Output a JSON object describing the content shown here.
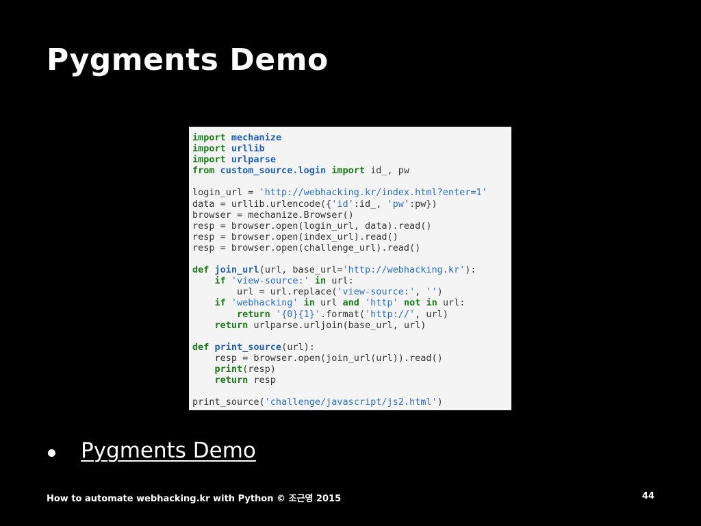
{
  "slide": {
    "title": "Pygments Demo",
    "bullet": "Pygments Demo",
    "footer": "How to automate webhacking.kr with Python © 조근영 2015",
    "page_number": "44"
  },
  "colors": {
    "background": "#000000",
    "text": "#ffffff",
    "code_background": "#f4f4f4",
    "keyword": "#1a7a1a",
    "name": "#1f5fb3",
    "string": "#2a6fbf",
    "plain": "#333333"
  },
  "code": {
    "language": "python",
    "lines": [
      [
        {
          "t": "kw",
          "v": "import"
        },
        {
          "t": "plain",
          "v": " "
        },
        {
          "t": "name",
          "v": "mechanize"
        }
      ],
      [
        {
          "t": "kw",
          "v": "import"
        },
        {
          "t": "plain",
          "v": " "
        },
        {
          "t": "name",
          "v": "urllib"
        }
      ],
      [
        {
          "t": "kw",
          "v": "import"
        },
        {
          "t": "plain",
          "v": " "
        },
        {
          "t": "name",
          "v": "urlparse"
        }
      ],
      [
        {
          "t": "kw",
          "v": "from"
        },
        {
          "t": "plain",
          "v": " "
        },
        {
          "t": "name",
          "v": "custom_source.login"
        },
        {
          "t": "plain",
          "v": " "
        },
        {
          "t": "kw",
          "v": "import"
        },
        {
          "t": "plain",
          "v": " id_, pw"
        }
      ],
      [],
      [
        {
          "t": "plain",
          "v": "login_url = "
        },
        {
          "t": "str",
          "v": "'http://webhacking.kr/index.html?enter=1'"
        }
      ],
      [
        {
          "t": "plain",
          "v": "data = urllib.urlencode({"
        },
        {
          "t": "str",
          "v": "'id'"
        },
        {
          "t": "plain",
          "v": ":id_, "
        },
        {
          "t": "str",
          "v": "'pw'"
        },
        {
          "t": "plain",
          "v": ":pw})"
        }
      ],
      [
        {
          "t": "plain",
          "v": "browser = mechanize.Browser()"
        }
      ],
      [
        {
          "t": "plain",
          "v": "resp = browser.open(login_url, data).read()"
        }
      ],
      [
        {
          "t": "plain",
          "v": "resp = browser.open(index_url).read()"
        }
      ],
      [
        {
          "t": "plain",
          "v": "resp = browser.open(challenge_url).read()"
        }
      ],
      [],
      [
        {
          "t": "kw",
          "v": "def"
        },
        {
          "t": "plain",
          "v": " "
        },
        {
          "t": "name",
          "v": "join_url"
        },
        {
          "t": "plain",
          "v": "(url, base_url="
        },
        {
          "t": "str",
          "v": "'http://webhacking.kr'"
        },
        {
          "t": "plain",
          "v": "):"
        }
      ],
      [
        {
          "t": "plain",
          "v": "    "
        },
        {
          "t": "kw",
          "v": "if"
        },
        {
          "t": "plain",
          "v": " "
        },
        {
          "t": "str",
          "v": "'view-source:'"
        },
        {
          "t": "plain",
          "v": " "
        },
        {
          "t": "kw",
          "v": "in"
        },
        {
          "t": "plain",
          "v": " url:"
        }
      ],
      [
        {
          "t": "plain",
          "v": "        url = url.replace("
        },
        {
          "t": "str",
          "v": "'view-source:'"
        },
        {
          "t": "plain",
          "v": ", "
        },
        {
          "t": "str",
          "v": "''"
        },
        {
          "t": "plain",
          "v": ")"
        }
      ],
      [
        {
          "t": "plain",
          "v": "    "
        },
        {
          "t": "kw",
          "v": "if"
        },
        {
          "t": "plain",
          "v": " "
        },
        {
          "t": "str",
          "v": "'webhacking'"
        },
        {
          "t": "plain",
          "v": " "
        },
        {
          "t": "kw",
          "v": "in"
        },
        {
          "t": "plain",
          "v": " url "
        },
        {
          "t": "kw",
          "v": "and"
        },
        {
          "t": "plain",
          "v": " "
        },
        {
          "t": "str",
          "v": "'http'"
        },
        {
          "t": "plain",
          "v": " "
        },
        {
          "t": "kw",
          "v": "not in"
        },
        {
          "t": "plain",
          "v": " url:"
        }
      ],
      [
        {
          "t": "plain",
          "v": "        "
        },
        {
          "t": "kw",
          "v": "return"
        },
        {
          "t": "plain",
          "v": " "
        },
        {
          "t": "str",
          "v": "'{0}{1}'"
        },
        {
          "t": "plain",
          "v": ".format("
        },
        {
          "t": "str",
          "v": "'http://'"
        },
        {
          "t": "plain",
          "v": ", url)"
        }
      ],
      [
        {
          "t": "plain",
          "v": "    "
        },
        {
          "t": "kw",
          "v": "return"
        },
        {
          "t": "plain",
          "v": " urlparse.urljoin(base_url, url)"
        }
      ],
      [],
      [
        {
          "t": "kw",
          "v": "def"
        },
        {
          "t": "plain",
          "v": " "
        },
        {
          "t": "name",
          "v": "print_source"
        },
        {
          "t": "plain",
          "v": "(url):"
        }
      ],
      [
        {
          "t": "plain",
          "v": "    resp = browser.open(join_url(url)).read()"
        }
      ],
      [
        {
          "t": "plain",
          "v": "    "
        },
        {
          "t": "kw",
          "v": "print"
        },
        {
          "t": "plain",
          "v": "(resp)"
        }
      ],
      [
        {
          "t": "plain",
          "v": "    "
        },
        {
          "t": "kw",
          "v": "return"
        },
        {
          "t": "plain",
          "v": " resp"
        }
      ],
      [],
      [
        {
          "t": "plain",
          "v": "print_source("
        },
        {
          "t": "str",
          "v": "'challenge/javascript/js2.html'"
        },
        {
          "t": "plain",
          "v": ")"
        }
      ]
    ]
  }
}
